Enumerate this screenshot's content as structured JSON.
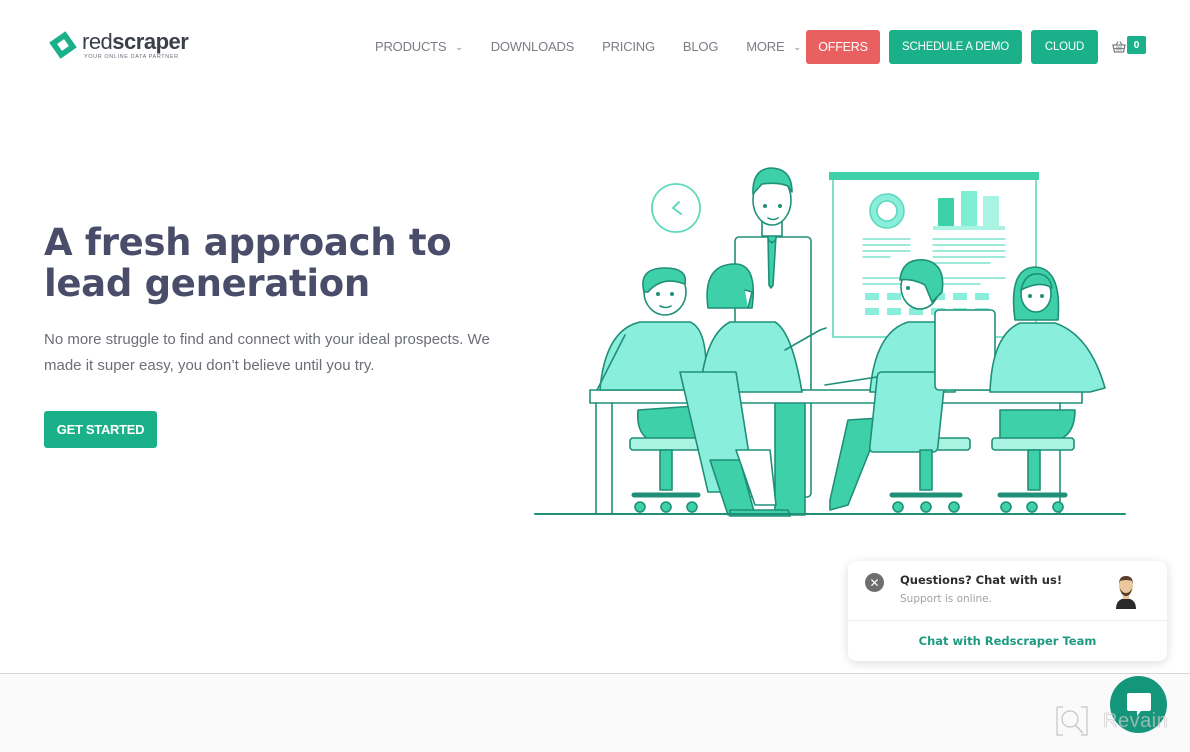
{
  "brand": {
    "name_part1": "red",
    "name_part2": "scraper",
    "tagline": "YOUR ONLINE DATA PARTNER",
    "accent_color": "#1ab08a",
    "offer_color": "#e86060",
    "logo_icon": "diamond-logo-icon"
  },
  "nav": {
    "items": [
      {
        "label": "PRODUCTS",
        "has_dropdown": true
      },
      {
        "label": "DOWNLOADS",
        "has_dropdown": false
      },
      {
        "label": "PRICING",
        "has_dropdown": false
      },
      {
        "label": "BLOG",
        "has_dropdown": false
      },
      {
        "label": "MORE",
        "has_dropdown": true
      }
    ],
    "dropdown_glyph": "⌄",
    "offers_label": "OFFERS",
    "demo_label": "SCHEDULE A DEMO",
    "cloud_label": "CLOUD",
    "cart_icon": "basket-icon",
    "cart_count": "0"
  },
  "hero": {
    "title_line1": "A fresh approach to",
    "title_line2": "lead generation",
    "description": "No more struggle to find and connect with your ideal prospects. We made it super easy, you don’t believe until you try.",
    "cta_label": "GET STARTED",
    "illustration": "team-meeting-illustration"
  },
  "chat": {
    "close_glyph": "✕",
    "title": "Questions? Chat with us!",
    "status": "Support is online.",
    "link_label": "Chat with Redscraper Team",
    "avatar": "support-agent-avatar",
    "bubble_icon": "chat-bubble-icon"
  },
  "watermark": {
    "text": "Revain"
  }
}
